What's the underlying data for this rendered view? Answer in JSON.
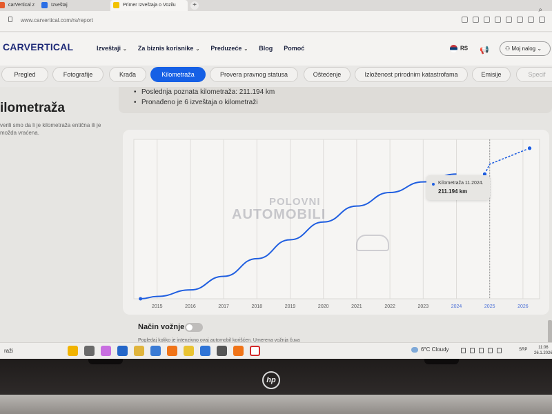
{
  "browser": {
    "tabs": [
      {
        "title": "carVertical z",
        "favicon_color": "#e55a2b"
      },
      {
        "title": "Izveštaj",
        "favicon_color": "#2b6ee5"
      },
      {
        "title": "Primer Izveštaja o Vozilu",
        "favicon_color": "#f2c200"
      }
    ],
    "new_tab": "+",
    "url": "www.carvertical.com/rs/report"
  },
  "header": {
    "logo": "CARVERTICAL",
    "nav": [
      {
        "label": "Izveštaji",
        "chevron": true
      },
      {
        "label": "Za biznis korisnike",
        "chevron": true
      },
      {
        "label": "Preduzeće",
        "chevron": true
      },
      {
        "label": "Blog",
        "chevron": false
      },
      {
        "label": "Pomoć",
        "chevron": false
      }
    ],
    "language": "RS",
    "account": "Moj nalog"
  },
  "pills": [
    {
      "label": "Pregled",
      "active": false
    },
    {
      "label": "Fotografije",
      "active": false
    },
    {
      "label": "Krađa",
      "active": false
    },
    {
      "label": "Kilometraža",
      "active": true
    },
    {
      "label": "Provera pravnog statusa",
      "active": false
    },
    {
      "label": "Oštećenje",
      "active": false
    },
    {
      "label": "Izloženost prirodnim katastrofama",
      "active": false
    },
    {
      "label": "Emisije",
      "active": false
    },
    {
      "label": "Specif",
      "active": false
    }
  ],
  "info": {
    "line1": "Poslednja poznata kilometraža: 211.194 km",
    "line2": "Pronađeno je 6 izveštaja o kilometraži"
  },
  "left": {
    "title": "ilometraža",
    "desc": "verili smo da li je kilometraža entična ili je možda vraćena."
  },
  "watermark": {
    "line1": "POLOVNI",
    "line2": "AUTOMOBILI"
  },
  "chart_data": {
    "type": "line",
    "x": [
      "2015",
      "2016",
      "2017",
      "2018",
      "2019",
      "2020",
      "2021",
      "2022",
      "2023",
      "2024",
      "2025",
      "2026"
    ],
    "years": [
      2014.5,
      2015,
      2016,
      2017,
      2018,
      2019,
      2020,
      2021,
      2022,
      2023,
      2024,
      2024.85
    ],
    "mileage_km": [
      0,
      4000,
      15000,
      38000,
      68000,
      100000,
      130000,
      157000,
      180000,
      198000,
      211194,
      211194
    ],
    "projection_years": [
      2024.85,
      2025,
      2026.2
    ],
    "projection_km": [
      211194,
      228000,
      255000
    ],
    "projection_color": "#1f5ee0",
    "line_color": "#1f5ee0",
    "current_year_marker": 2025,
    "ylim": [
      0,
      270000
    ],
    "xlim": [
      2014.3,
      2026.5
    ],
    "grid": true,
    "tooltip": {
      "label": "Kilometraža 11.2024.",
      "value": "211.194 km"
    }
  },
  "driving": {
    "label": "Način vožnje",
    "hint": "Pogledaj koliko je intenzivno ovaj automobil korišćen. Umerena vožnja čuva"
  },
  "taskbar": {
    "search": "raži",
    "icons": [
      "#f1b300",
      "#6a6a6a",
      "#c86ee0",
      "#2466c8",
      "#e0b43c",
      "#3a7bd5",
      "#f07418",
      "#e9c332",
      "#2f74d6",
      "#555555",
      "#f07418",
      "#d22a2a"
    ],
    "weather": "6°C  Cloudy",
    "lang": "SRP",
    "time": "11:06",
    "date": "26.1.2026"
  },
  "laptop": {
    "brand": "hp"
  }
}
